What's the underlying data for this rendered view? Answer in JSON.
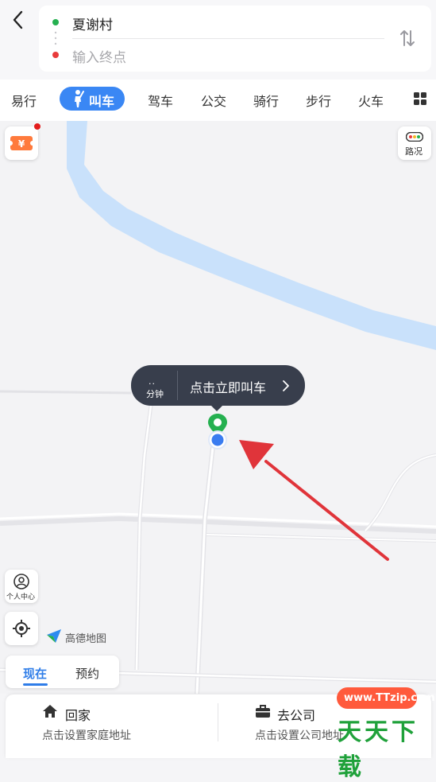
{
  "header": {
    "origin": "夏谢村",
    "destination_placeholder": "输入终点"
  },
  "tabs": [
    {
      "label": "易行"
    },
    {
      "label": "叫车",
      "active": true
    },
    {
      "label": "驾车"
    },
    {
      "label": "公交"
    },
    {
      "label": "骑行"
    },
    {
      "label": "步行"
    },
    {
      "label": "火车"
    }
  ],
  "map": {
    "traffic_label": "路况",
    "profile_label": "个人中心",
    "brand_label": "高德地图",
    "bubble": {
      "eta_dots": "..",
      "eta_unit": "分钟",
      "cta": "点击立即叫车"
    }
  },
  "timing": {
    "now": "现在",
    "later": "预约"
  },
  "shortcuts": {
    "home_title": "回家",
    "home_subtitle": "点击设置家庭地址",
    "company_title": "去公司",
    "company_subtitle": "点击设置公司地址"
  },
  "watermark": {
    "site": "www.TTzip.com",
    "brand": "天天下载"
  },
  "colors": {
    "accent": "#3a87f4",
    "river": "#c9e1fb",
    "bubble": "#383e4c",
    "arrow": "#e0343a",
    "origin_dot": "#25b050",
    "destination_dot": "#e83b3b"
  }
}
